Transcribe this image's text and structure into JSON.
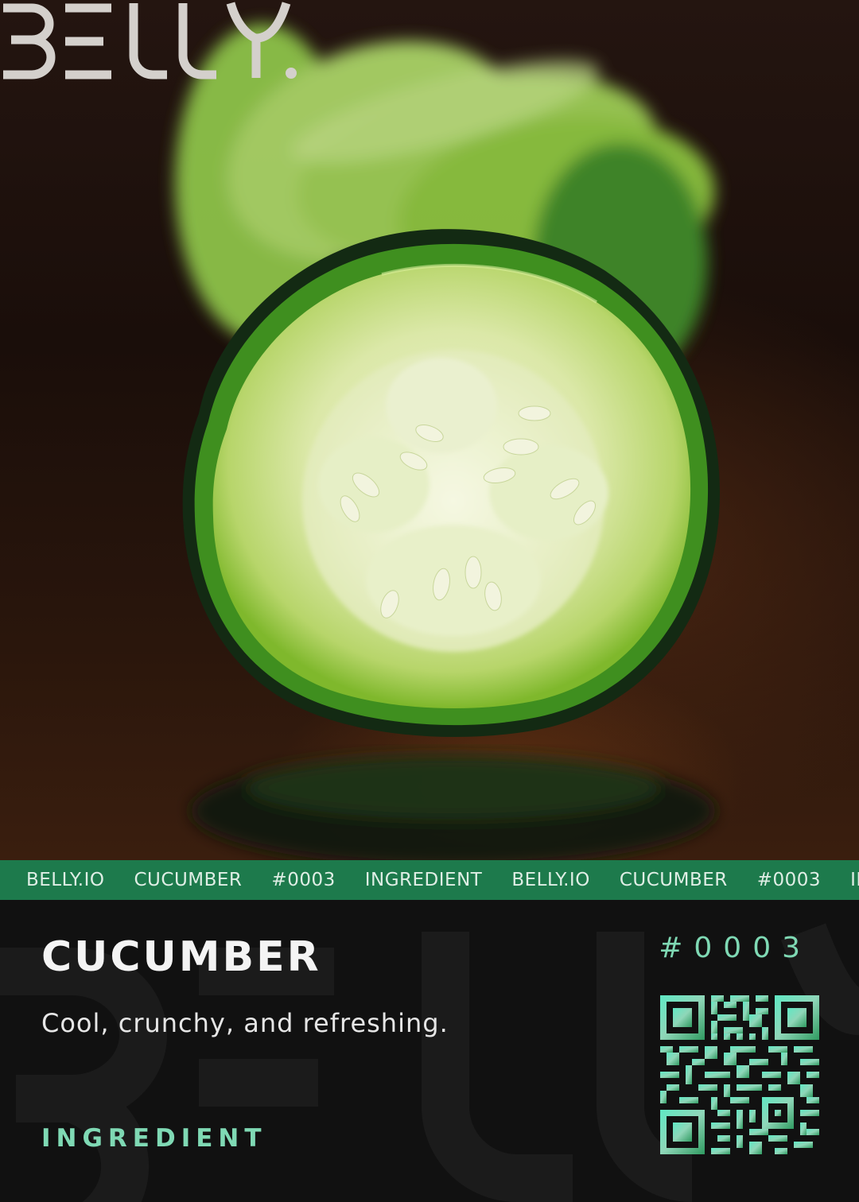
{
  "brand": {
    "logo_text": "BELLY."
  },
  "ticker": {
    "items": [
      "BELLY.IO",
      "CUCUMBER",
      "#0003",
      "INGREDIENT",
      "BELLY.IO",
      "CUCUMBER",
      "#0003",
      "INGREDIENT"
    ]
  },
  "card": {
    "title": "CUCUMBER",
    "tagline": "Cool, crunchy, and refreshing.",
    "category": "INGREDIENT",
    "number": "#0003"
  },
  "icons": {
    "qr": "qr-code-icon",
    "photo": "cucumber-slice-photo"
  },
  "colors": {
    "accent_green": "#1d7a4c",
    "mint": "#7fd9b4",
    "background": "#121212"
  }
}
